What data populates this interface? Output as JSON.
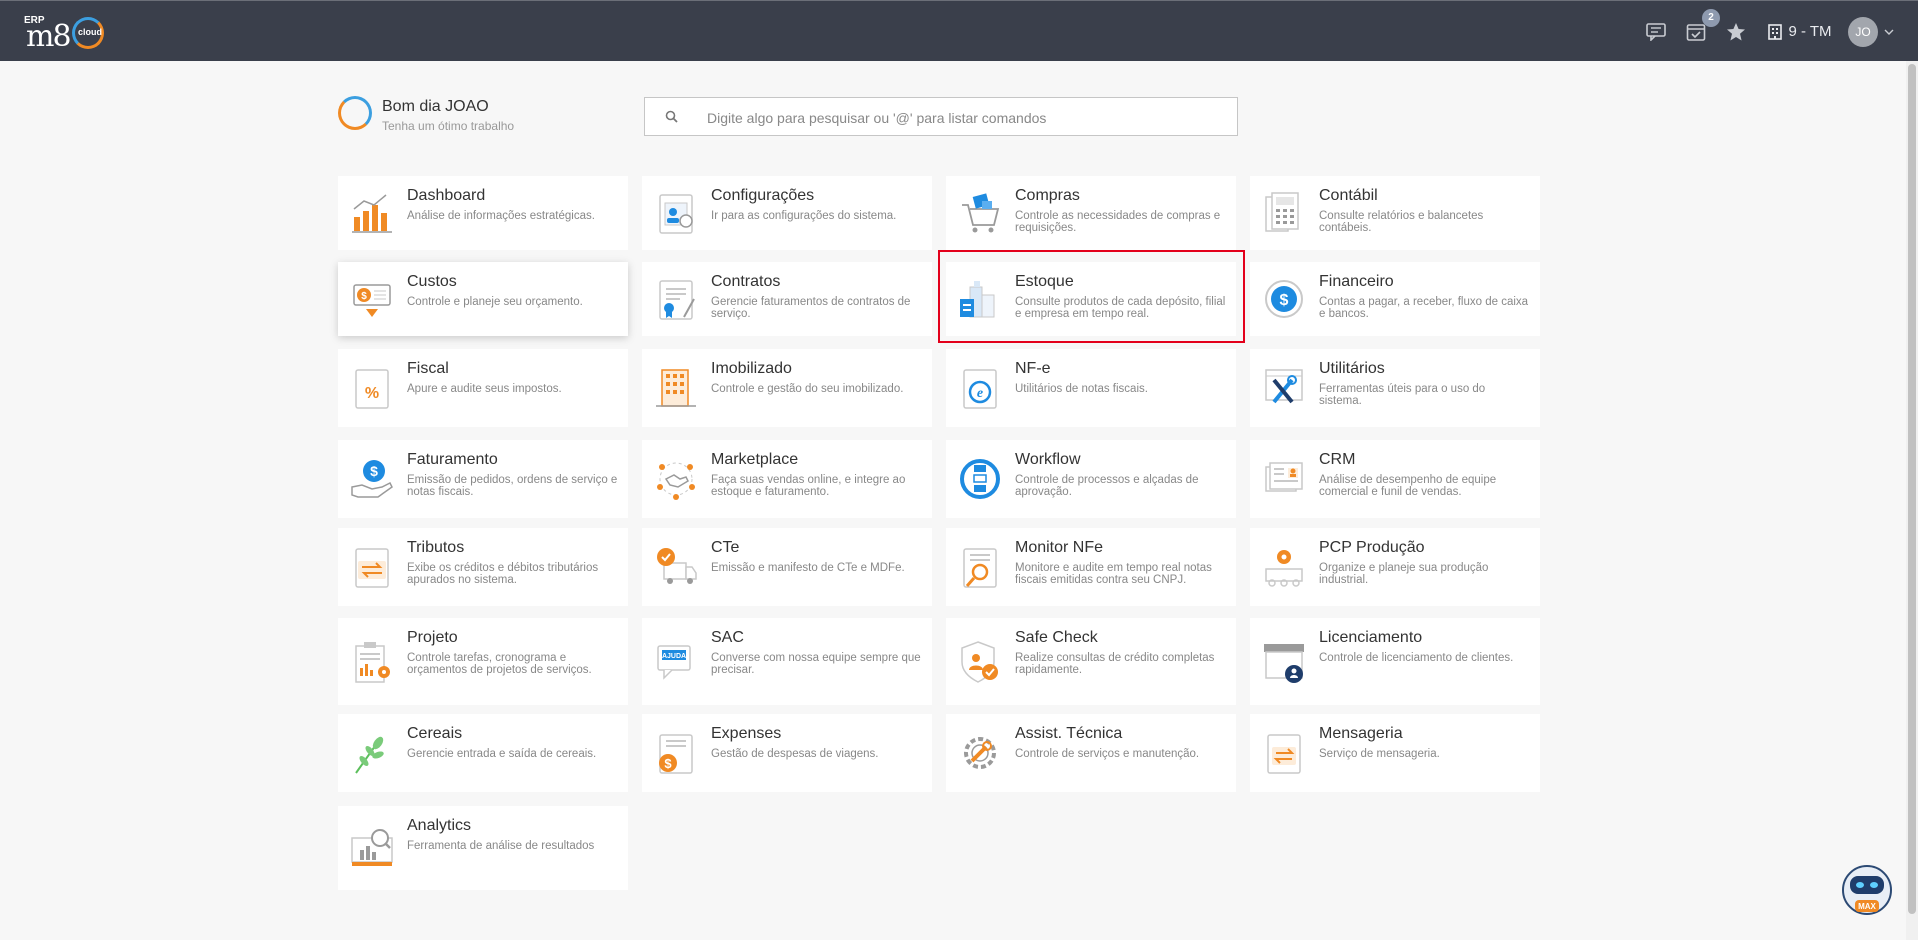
{
  "header": {
    "logo_erp": "ERP",
    "logo_m8": "m8",
    "logo_cloud": "cloud",
    "notification_badge": "2",
    "company": "9 - TM",
    "user_initials": "JO"
  },
  "greeting": {
    "title": "Bom dia JOAO",
    "subtitle": "Tenha um ótimo trabalho"
  },
  "search": {
    "placeholder": "Digite algo para pesquisar ou '@' para listar comandos"
  },
  "modules": [
    {
      "title": "Dashboard",
      "desc": "Análise de informações estratégicas.",
      "icon": "dashboard-chart-icon"
    },
    {
      "title": "Configurações",
      "desc": "Ir para as configurações do sistema.",
      "icon": "settings-profile-icon"
    },
    {
      "title": "Compras",
      "desc": "Controle as necessidades de compras e requisições.",
      "icon": "shopping-cart-icon"
    },
    {
      "title": "Contábil",
      "desc": "Consulte relatórios e balancetes contábeis.",
      "icon": "calculator-icon"
    },
    {
      "title": "Custos",
      "desc": "Controle e planeje seu orçamento.",
      "icon": "money-icon"
    },
    {
      "title": "Contratos",
      "desc": "Gerencie faturamentos de contratos de serviço.",
      "icon": "contract-icon"
    },
    {
      "title": "Estoque",
      "desc": "Consulte produtos de cada depósito, filial e empresa em tempo real.",
      "icon": "warehouse-icon"
    },
    {
      "title": "Financeiro",
      "desc": "Contas a pagar, a receber, fluxo de caixa e bancos.",
      "icon": "dollar-coin-icon"
    },
    {
      "title": "Fiscal",
      "desc": "Apure e audite seus impostos.",
      "icon": "percent-document-icon"
    },
    {
      "title": "Imobilizado",
      "desc": "Controle e gestão do seu imobilizado.",
      "icon": "building-icon"
    },
    {
      "title": "NF-e",
      "desc": "Utilitários de notas fiscais.",
      "icon": "e-document-icon"
    },
    {
      "title": "Utilitários",
      "desc": "Ferramentas úteis para o uso do sistema.",
      "icon": "tools-icon"
    },
    {
      "title": "Faturamento",
      "desc": "Emissão de pedidos, ordens de serviço e notas fiscais.",
      "icon": "billing-hand-icon"
    },
    {
      "title": "Marketplace",
      "desc": "Faça suas vendas online, e integre ao estoque e faturamento.",
      "icon": "handshake-icon"
    },
    {
      "title": "Workflow",
      "desc": "Controle de processos e alçadas de aprovação.",
      "icon": "workflow-icon"
    },
    {
      "title": "CRM",
      "desc": "Análise de desempenho de equipe comercial e funil de vendas.",
      "icon": "crm-card-icon"
    },
    {
      "title": "Tributos",
      "desc": "Exibe os créditos e débitos tributários apurados no sistema.",
      "icon": "tax-transfer-icon"
    },
    {
      "title": "CTe",
      "desc": "Emissão e manifesto de CTe e MDFe.",
      "icon": "truck-check-icon"
    },
    {
      "title": "Monitor NFe",
      "desc": "Monitore e audite em tempo real notas fiscais emitidas contra seu CNPJ.",
      "icon": "magnifier-document-icon"
    },
    {
      "title": "PCP Produção",
      "desc": "Organize e planeje sua produção industrial.",
      "icon": "production-gear-icon"
    },
    {
      "title": "Projeto",
      "desc": "Controle tarefas, cronograma e orçamentos de projetos de serviços.",
      "icon": "project-clipboard-icon"
    },
    {
      "title": "SAC",
      "desc": "Converse com nossa equipe sempre que precisar.",
      "icon": "help-chat-icon"
    },
    {
      "title": "Safe Check",
      "desc": "Realize consultas de crédito completas rapidamente.",
      "icon": "shield-check-icon"
    },
    {
      "title": "Licenciamento",
      "desc": "Controle de licenciamento de clientes.",
      "icon": "license-store-icon"
    },
    {
      "title": "Cereais",
      "desc": "Gerencie entrada e saída de cereais.",
      "icon": "wheat-icon"
    },
    {
      "title": "Expenses",
      "desc": "Gestão de despesas de viagens.",
      "icon": "expenses-icon"
    },
    {
      "title": "Assist. Técnica",
      "desc": "Controle de serviços e manutenção.",
      "icon": "wrench-gear-icon"
    },
    {
      "title": "Mensageria",
      "desc": "Serviço de mensageria.",
      "icon": "messaging-icon"
    },
    {
      "title": "Analytics",
      "desc": "Ferramenta de análise de resultados",
      "icon": "analytics-monitor-icon"
    }
  ],
  "colors": {
    "topbar": "#3a3f4b",
    "accent_orange": "#f08a24",
    "accent_blue": "#1e8be0",
    "highlight": "#e3001b"
  },
  "assistant": {
    "label": "MAX"
  }
}
